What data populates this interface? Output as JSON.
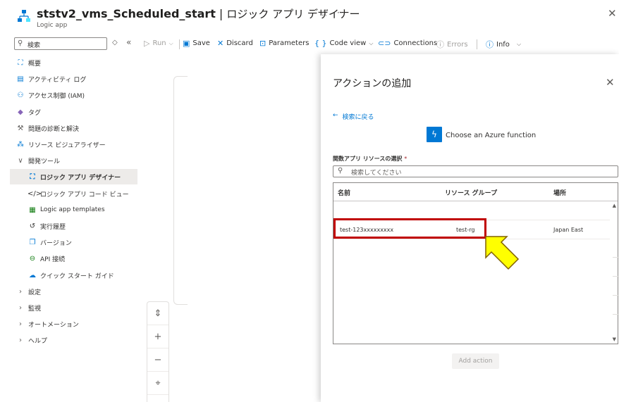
{
  "header": {
    "title": "ststv2_vms_Scheduled_start",
    "separator": "|",
    "subtitle_right": "ロジック アプリ デザイナー",
    "resource_type": "Logic app",
    "star_icon": "star-icon",
    "more": "···",
    "close": "✕"
  },
  "sidebar": {
    "search_placeholder": "検索",
    "items": [
      {
        "label": "概要",
        "icon": "overview-icon",
        "glyph": "⛶",
        "color": "#0078d4",
        "level": 0
      },
      {
        "label": "アクティビティ ログ",
        "icon": "activity-log-icon",
        "glyph": "▤",
        "color": "#0078d4",
        "level": 0
      },
      {
        "label": "アクセス制御 (IAM)",
        "icon": "iam-icon",
        "glyph": "⚇",
        "color": "#0078d4",
        "level": 0
      },
      {
        "label": "タグ",
        "icon": "tag-icon",
        "glyph": "◆",
        "color": "#8764b8",
        "level": 0
      },
      {
        "label": "問題の診断と解決",
        "icon": "wrench-icon",
        "glyph": "⚒",
        "color": "#605e5c",
        "level": 0
      },
      {
        "label": "リソース ビジュアライザー",
        "icon": "visualizer-icon",
        "glyph": "⁂",
        "color": "#0078d4",
        "level": 0
      },
      {
        "label": "開発ツール",
        "icon": "chevron-down-icon",
        "glyph": "∨",
        "color": "#605e5c",
        "level": 0
      },
      {
        "label": "ロジック アプリ デザイナー",
        "icon": "designer-icon",
        "glyph": "⛶",
        "color": "#0078d4",
        "level": 1,
        "active": true
      },
      {
        "label": "ロジック アプリ コード ビュー",
        "icon": "code-icon",
        "glyph": "</>",
        "color": "#323130",
        "level": 1
      },
      {
        "label": "Logic app templates",
        "icon": "templates-icon",
        "glyph": "▦",
        "color": "#107c10",
        "level": 1
      },
      {
        "label": "実行履歴",
        "icon": "history-icon",
        "glyph": "↺",
        "color": "#323130",
        "level": 1
      },
      {
        "label": "バージョン",
        "icon": "versions-icon",
        "glyph": "❐",
        "color": "#0078d4",
        "level": 1
      },
      {
        "label": "API 接続",
        "icon": "api-connection-icon",
        "glyph": "⊖",
        "color": "#107c10",
        "level": 1
      },
      {
        "label": "クイック スタート ガイド",
        "icon": "quickstart-icon",
        "glyph": "☁",
        "color": "#0078d4",
        "level": 1
      },
      {
        "label": "設定",
        "icon": "chevron-right-icon",
        "glyph": "›",
        "color": "#605e5c",
        "level": 0
      },
      {
        "label": "監視",
        "icon": "chevron-right-icon",
        "glyph": "›",
        "color": "#605e5c",
        "level": 0
      },
      {
        "label": "オートメーション",
        "icon": "chevron-right-icon",
        "glyph": "›",
        "color": "#605e5c",
        "level": 0
      },
      {
        "label": "ヘルプ",
        "icon": "chevron-right-icon",
        "glyph": "›",
        "color": "#605e5c",
        "level": 0
      }
    ]
  },
  "toolbar": {
    "run": "Run",
    "save": "Save",
    "discard": "Discard",
    "parameters": "Parameters",
    "code_view": "Code view",
    "connections": "Connections",
    "errors": "Errors",
    "info": "Info"
  },
  "panel": {
    "title": "アクションの追加",
    "back_link": "検索に戻る",
    "function_label": "Choose an Azure function",
    "field_label": "関数アプリ リソースの選択",
    "required_mark": "*",
    "search_placeholder": "検索してください",
    "columns": [
      "名前",
      "リソース グループ",
      "場所"
    ],
    "rows": [
      {
        "name": "test-123xxxxxxxxx",
        "resource_group": "test-rg",
        "location": "Japan East"
      }
    ],
    "add_action": "Add action"
  },
  "colors": {
    "accent": "#0078d4",
    "highlight_border": "#c00000",
    "arrow_fill": "#ffff00"
  }
}
